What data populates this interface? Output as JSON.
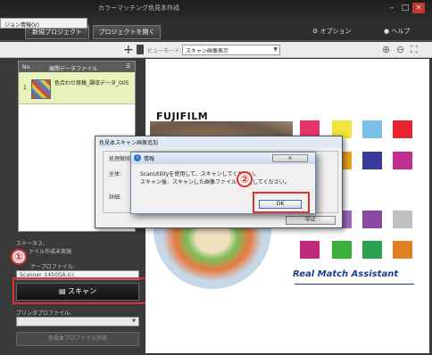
{
  "window": {
    "title": "カラーマッチング色見本作成",
    "menu_popup": "ジョン情報(V)",
    "controls": [
      "–",
      "□",
      "×"
    ]
  },
  "toolbar": {
    "new_project": "新規プロジェクト",
    "open_project": "プロジェクトを開く",
    "options": "オプション",
    "help": "ヘルプ"
  },
  "subbar": {
    "view_mode_label": "ビューモード:",
    "view_mode_value": "スキャン画像表示"
  },
  "file_list": {
    "headers": [
      "No.",
      "展開データファイル",
      "☰"
    ],
    "rows": [
      {
        "no": "1",
        "name": "色合わせ原稿_課収データ_005"
      }
    ]
  },
  "left": {
    "status_label": "ステータス:",
    "status_value": "ァイル作成未実施",
    "scanner_profile_label": "ナープロファイル:",
    "scanner_profile_value": "Scanner_1450GA.icc",
    "scan_button": "スキャン",
    "printer_profile_label": "プリンタプロファイル:",
    "create_button": "色見本プロファイル作成"
  },
  "canvas": {
    "brand": "FUJIFILM",
    "product": "Real Match Assistant",
    "swatches": [
      "#e6336a",
      "#f0e33b",
      "#7ac0e8",
      "#e8242e",
      "#58c0c8",
      "#e8a020",
      "#3a3a9a",
      "#c03090",
      "#8aaae0",
      "#9a6abf",
      "#8a4aa0",
      "#c0c0c0",
      "#c02a7a",
      "#3cb03c",
      "#2aa050",
      "#e08020"
    ]
  },
  "back_dialog": {
    "title": "色見本スキャン画像追加",
    "group": "処理継続",
    "row1": "全体:",
    "row2": "詳細:",
    "cancel": "中止"
  },
  "dialog": {
    "title": "情報",
    "close": "✕",
    "message_line1": "ScanUtilityを使用して、スキャンしてください。",
    "message_line2": "スキャン後、スキャンした画像ファイルを指定してください。",
    "ok": "OK"
  },
  "annotations": {
    "step1": "①",
    "step2": "②",
    "highlight_color": "#e03030"
  }
}
